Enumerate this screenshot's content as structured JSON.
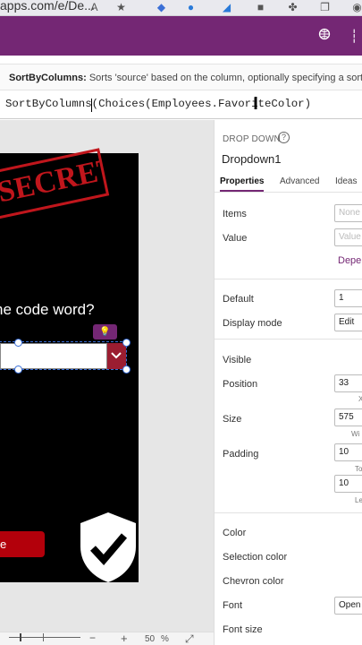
{
  "browser": {
    "url": "apps.com/e/De...",
    "reader_icon": "A"
  },
  "header": {
    "icons": [
      "environment-icon",
      "more-icon"
    ]
  },
  "tooltip": {
    "name": "SortByColumns:",
    "text": "Sorts 'source' based on the column, optionally specifying a sort 'or"
  },
  "formula": {
    "text": "SortByColumns(Choices(Employees.FavoriteColor)"
  },
  "canvas": {
    "stamp": "SECRET",
    "question": "he code word?",
    "button_label": "e",
    "zoom": "50",
    "zoom_unit": "%",
    "zoom_minus": "−",
    "zoom_plus": "+"
  },
  "pane": {
    "control_type": "DROP DOWN",
    "help": "?",
    "control_name": "Dropdown1",
    "tabs": [
      "Properties",
      "Advanced",
      "Ideas"
    ],
    "items_label": "Items",
    "items_value": "None",
    "value_label": "Value",
    "value_value": "Value",
    "dep_link": "Depe",
    "default_label": "Default",
    "default_value": "1",
    "display_mode_label": "Display mode",
    "display_mode_value": "Edit",
    "visible_label": "Visible",
    "position_label": "Position",
    "position_value": "33",
    "position_sub": "X",
    "size_label": "Size",
    "size_value": "575",
    "size_sub": "Wi",
    "padding_label": "Padding",
    "padding_top": "10",
    "padding_top_sub": "To",
    "padding_left": "10",
    "padding_left_sub": "Le",
    "color_label": "Color",
    "selection_color_label": "Selection color",
    "chevron_color_label": "Chevron color",
    "font_label": "Font",
    "font_value": "Open",
    "font_size_label": "Font size"
  }
}
